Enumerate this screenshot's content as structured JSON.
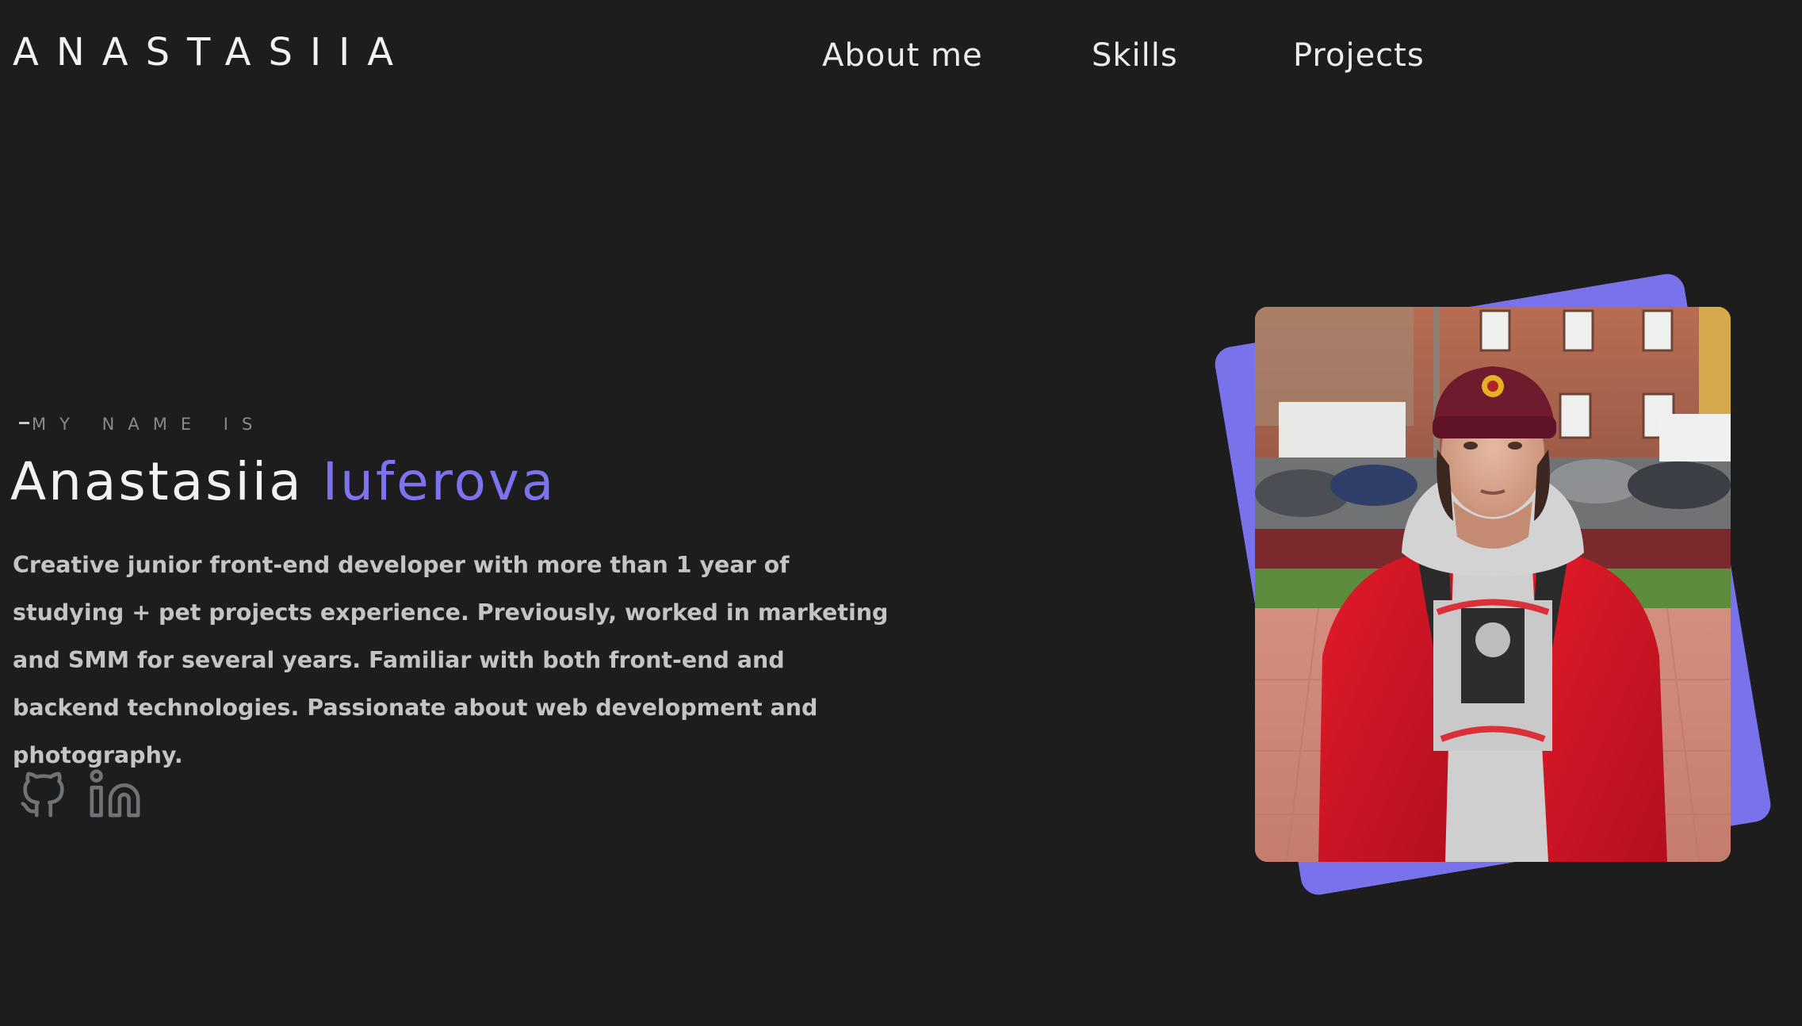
{
  "header": {
    "logo": "ANASTASIIA",
    "nav": {
      "about": "About me",
      "skills": "Skills",
      "projects": "Projects"
    }
  },
  "hero": {
    "label": "MY NAME IS",
    "first_name": "Anastasiia",
    "last_name": "Iuferova",
    "bio": "Creative junior front-end developer with more than 1 year of studying + pet projects experience. Previously, worked in marketing and SMM for several years. Familiar with both front-end and backend technologies. Passionate about web development and photography.",
    "socials": [
      {
        "icon": "github-icon"
      },
      {
        "icon": "linkedin-icon"
      }
    ]
  },
  "colors": {
    "background": "#1d1d1d",
    "accent": "#7d73ee",
    "text": "#f2f2f2",
    "muted": "#c4c4c4",
    "icon": "#6f7375"
  }
}
